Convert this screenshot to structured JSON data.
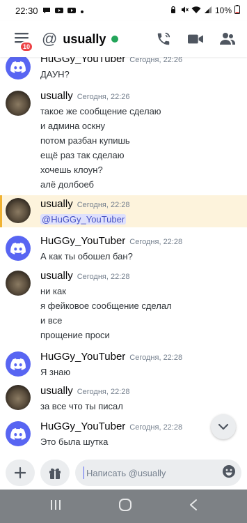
{
  "status_bar": {
    "time": "22:30",
    "battery": "10%"
  },
  "header": {
    "badge": "10",
    "at_symbol": "@",
    "title": "usually",
    "online_color": "#23a55a"
  },
  "messages": [
    {
      "author": "HuGGy_YouTuber",
      "time": "Сегодня, 22:26",
      "avatar": "discord",
      "lines": [
        "ДАУН?"
      ]
    },
    {
      "author": "usually",
      "time": "Сегодня, 22:26",
      "avatar": "cat",
      "lines": [
        "такое же сообщение сделаю",
        "и админа оскну",
        "потом разбан купишь",
        "ещё раз так сделаю",
        "хочешь клоун?",
        "алё долбоеб"
      ]
    },
    {
      "author": "usually",
      "time": "Сегодня, 22:28",
      "avatar": "cat",
      "mention": "@HuGGy_YouTuber"
    },
    {
      "author": "HuGGy_YouTuber",
      "time": "Сегодня, 22:28",
      "avatar": "discord",
      "lines": [
        "А как ты обошел бан?"
      ]
    },
    {
      "author": "usually",
      "time": "Сегодня, 22:28",
      "avatar": "cat",
      "lines": [
        "ни как",
        "я фейковое сообщение сделал",
        "и все",
        "прощение проси"
      ]
    },
    {
      "author": "HuGGy_YouTuber",
      "time": "Сегодня, 22:28",
      "avatar": "discord",
      "lines": [
        "Я знаю"
      ]
    },
    {
      "author": "usually",
      "time": "Сегодня, 22:28",
      "avatar": "cat",
      "lines": [
        "за все что ты писал"
      ]
    },
    {
      "author": "HuGGy_YouTuber",
      "time": "Сегодня, 22:28",
      "avatar": "discord",
      "lines": [
        "Это была шутка"
      ]
    }
  ],
  "composer": {
    "placeholder": "Написать @usually"
  },
  "colors": {
    "brand": "#5865f2",
    "mention_bg": "#dee0fc",
    "highlight_bg": "#fdf3dc",
    "highlight_bar": "#f0b232",
    "badge": "#ed4245"
  },
  "icons": [
    "menu-icon",
    "at-icon",
    "phone-icon",
    "video-icon",
    "members-icon",
    "chevron-down-icon",
    "plus-icon",
    "gift-icon",
    "emoji-icon",
    "recents-icon",
    "home-icon",
    "back-icon"
  ]
}
